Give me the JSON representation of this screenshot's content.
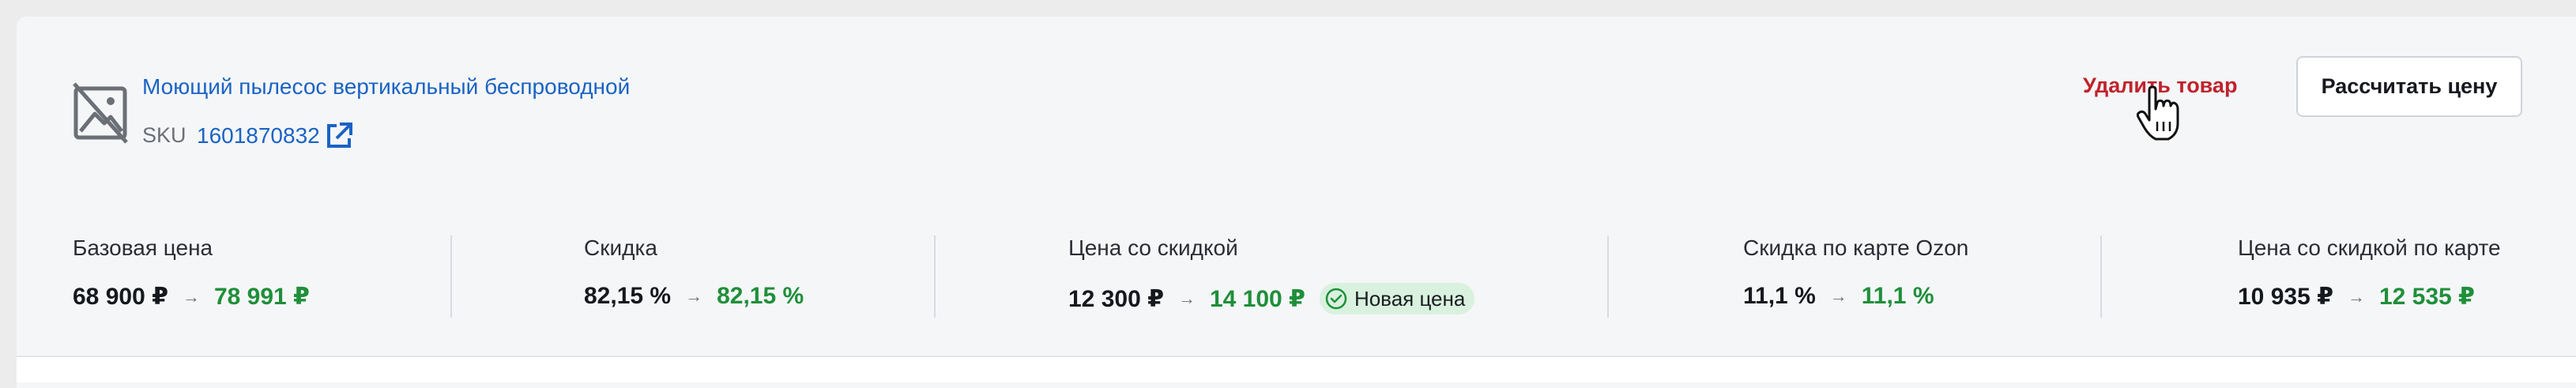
{
  "product": {
    "name": "Моющий пылесос вертикальный беспроводной",
    "sku_label": "SKU",
    "sku_value": "1601870832",
    "image_icon": "no-image-icon",
    "link_icon": "external-link-icon"
  },
  "actions": {
    "delete_label": "Удалить товар",
    "calc_label": "Рассчитать цену"
  },
  "metrics": [
    {
      "label": "Базовая цена",
      "old": "68 900 ₽",
      "new": "78 991 ₽"
    },
    {
      "label": "Скидка",
      "old": "82,15 %",
      "new": "82,15 %"
    },
    {
      "label": "Цена со скидкой",
      "old": "12 300 ₽",
      "new": "14 100 ₽",
      "badge": "Новая цена"
    },
    {
      "label": "Скидка по карте Ozon",
      "old": "11,1 %",
      "new": "11,1 %"
    },
    {
      "label": "Цена со скидкой по карте",
      "old": "10 935 ₽",
      "new": "12 535 ₽"
    }
  ],
  "colors": {
    "link": "#1a63c4",
    "danger": "#c0232c",
    "positive": "#1f8f3a",
    "badge_bg": "#d9f1de"
  }
}
